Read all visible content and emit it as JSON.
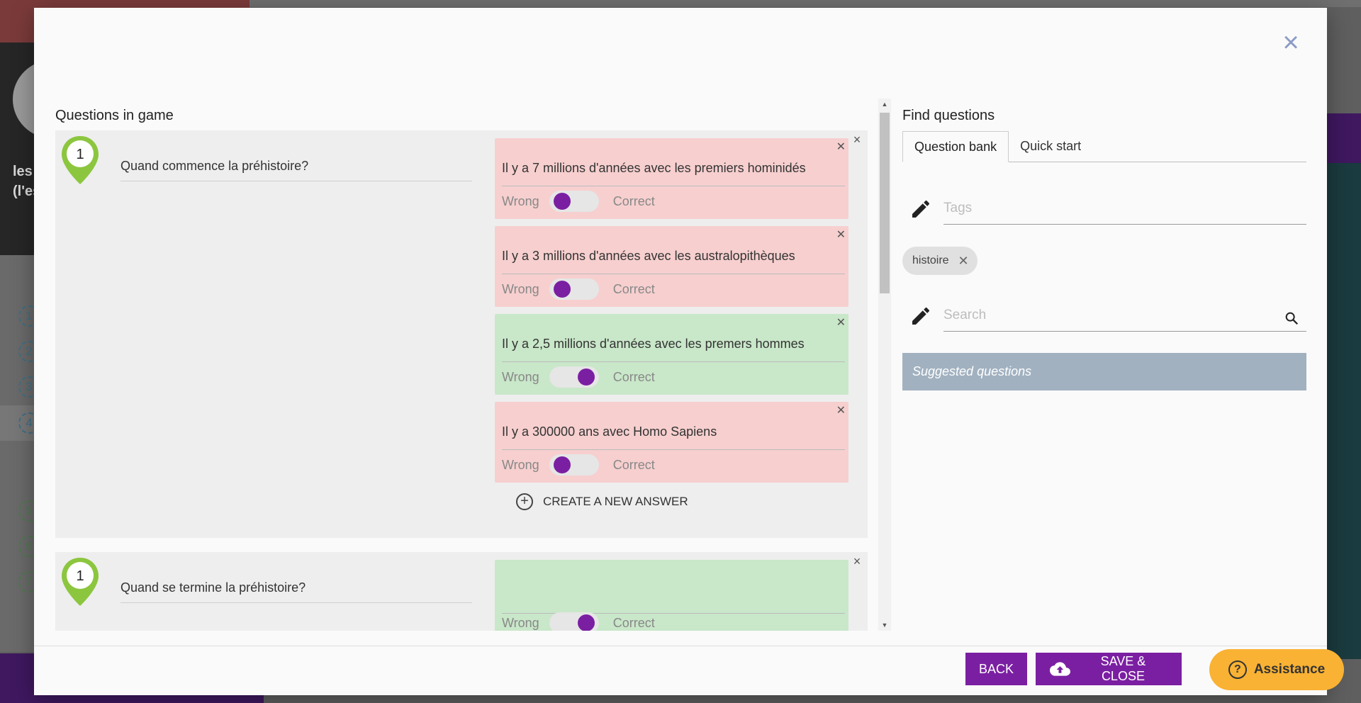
{
  "background": {
    "side_text_line1": "les",
    "side_text_line2": "(l'es",
    "side_numbers": [
      "1",
      "2",
      "3",
      "4",
      "5",
      "6",
      "7"
    ]
  },
  "modal": {
    "close_icon": "close-icon",
    "left_title": "Questions in game",
    "questions": [
      {
        "number": "1",
        "text": "Quand commence la préhistoire?",
        "answers": [
          {
            "text": "Il y a 7 millions d'années avec les premiers hominidés",
            "state": "wrong"
          },
          {
            "text": "Il y a 3 millions d'années avec les australopithèques",
            "state": "wrong"
          },
          {
            "text": "Il y a 2,5 millions d'années avec les premers hommes",
            "state": "correct"
          },
          {
            "text": "Il y a 300000 ans avec Homo Sapiens",
            "state": "wrong"
          }
        ],
        "create_answer_label": "CREATE A NEW ANSWER"
      },
      {
        "number": "1",
        "text": "Quand se termine la préhistoire?",
        "answers": [
          {
            "text": "",
            "state": "correct"
          }
        ]
      }
    ],
    "toggle_labels": {
      "wrong": "Wrong",
      "correct": "Correct"
    },
    "right_title": "Find questions",
    "tabs": [
      "Question bank",
      "Quick start"
    ],
    "active_tab": "Question bank",
    "tags_placeholder": "Tags",
    "tag_chips": [
      "histoire"
    ],
    "search_placeholder": "Search",
    "suggested_label": "Suggested questions",
    "back_label": "BACK",
    "save_label": "SAVE & CLOSE"
  },
  "assistance_label": "Assistance",
  "colors": {
    "accent": "#7b1fa2",
    "wrong_bg": "#f7cfcf",
    "correct_bg": "#c9e7c9",
    "suggested_bg": "#a1b1c0",
    "assist_bg": "#f9b233"
  }
}
